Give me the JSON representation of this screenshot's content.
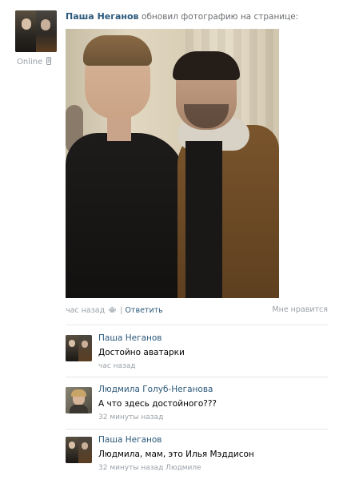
{
  "post": {
    "author": "Паша Неганов",
    "action": "обновил фотографию на странице:",
    "status": "Online",
    "time": "час назад",
    "reply_label": "Ответить",
    "like_label": "Мне нравится"
  },
  "comments": [
    {
      "author": "Паша Неганов",
      "text": "Достойно аватарки",
      "time": "час назад",
      "reply_to": ""
    },
    {
      "author": "Людмила Голуб-Неганова",
      "text": "А что здесь достойного???",
      "time": "32 минуты назад",
      "reply_to": ""
    },
    {
      "author": "Паша Неганов",
      "text": "Людмила, мам, это Илья Мэддисон",
      "time": "32 минуты назад",
      "reply_to": "Людмиле"
    }
  ],
  "colors": {
    "link": "#2b587a",
    "muted": "#9aa0a6",
    "separator": "#e4e6e9"
  },
  "icons": [
    "mobile-icon",
    "android-icon"
  ]
}
